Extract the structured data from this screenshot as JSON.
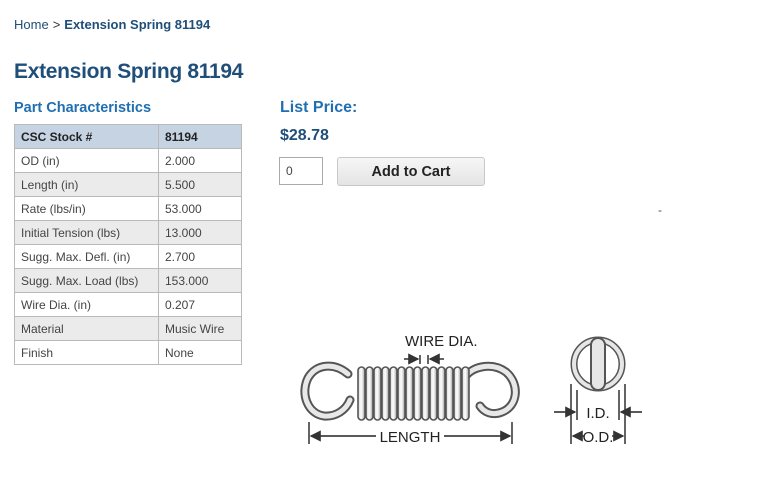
{
  "breadcrumb": {
    "home": "Home",
    "separator": ">",
    "current": "Extension Spring 81194"
  },
  "page_title": "Extension Spring 81194",
  "characteristics": {
    "title": "Part Characteristics",
    "header": {
      "label": "CSC Stock #",
      "value": "81194"
    },
    "rows": [
      {
        "label": "OD (in)",
        "value": "2.000"
      },
      {
        "label": "Length (in)",
        "value": "5.500"
      },
      {
        "label": "Rate (lbs/in)",
        "value": "53.000"
      },
      {
        "label": "Initial Tension (lbs)",
        "value": "13.000"
      },
      {
        "label": "Sugg. Max. Defl. (in)",
        "value": "2.700"
      },
      {
        "label": "Sugg. Max. Load (lbs)",
        "value": "153.000"
      },
      {
        "label": "Wire Dia. (in)",
        "value": "0.207"
      },
      {
        "label": "Material",
        "value": "Music Wire"
      },
      {
        "label": "Finish",
        "value": "None"
      }
    ]
  },
  "pricing": {
    "label": "List Price:",
    "price": "$28.78",
    "quantity": "0",
    "add_to_cart": "Add to Cart",
    "dash": "-"
  },
  "diagram": {
    "wire_dia_label": "WIRE DIA.",
    "length_label": "LENGTH",
    "id_label": "I.D.",
    "od_label": "O.D."
  },
  "colors": {
    "title_blue": "#1f4e79",
    "accent_blue": "#1f6fb2",
    "table_header_bg": "#c5d3e2",
    "table_alt_row_bg": "#ebebeb"
  }
}
